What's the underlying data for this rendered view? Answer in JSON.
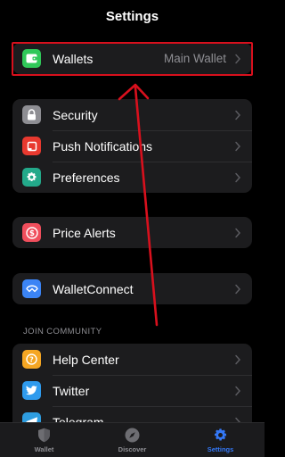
{
  "header": {
    "title": "Settings"
  },
  "groups": [
    {
      "items": [
        {
          "label": "Wallets",
          "value": "Main Wallet",
          "icon": "wallet-icon",
          "color": "#30c859"
        }
      ]
    },
    {
      "items": [
        {
          "label": "Security",
          "icon": "lock-icon",
          "color": "#8e8e93"
        },
        {
          "label": "Push Notifications",
          "icon": "notification-icon",
          "color": "#e8392f"
        },
        {
          "label": "Preferences",
          "icon": "gear-icon",
          "color": "#23a98a"
        }
      ]
    },
    {
      "items": [
        {
          "label": "Price Alerts",
          "icon": "price-alert-icon",
          "color": "#f04e5c"
        }
      ]
    },
    {
      "items": [
        {
          "label": "WalletConnect",
          "icon": "walletconnect-icon",
          "color": "#3b84f5"
        }
      ]
    },
    {
      "header": "JOIN COMMUNITY",
      "items": [
        {
          "label": "Help Center",
          "icon": "help-icon",
          "color": "#f5a623"
        },
        {
          "label": "Twitter",
          "icon": "twitter-icon",
          "color": "#2f9bee"
        },
        {
          "label": "Telegram",
          "icon": "telegram-icon",
          "color": "#2e9de0"
        }
      ]
    }
  ],
  "tabbar": {
    "tabs": [
      {
        "label": "Wallet",
        "icon": "shield-icon",
        "active": false
      },
      {
        "label": "Discover",
        "icon": "compass-icon",
        "active": false
      },
      {
        "label": "Settings",
        "icon": "gear-icon",
        "active": true
      }
    ]
  },
  "colors": {
    "accent": "#3478f6",
    "annotation": "#d8101d",
    "background": "#000000",
    "cell": "#1c1c1e"
  }
}
